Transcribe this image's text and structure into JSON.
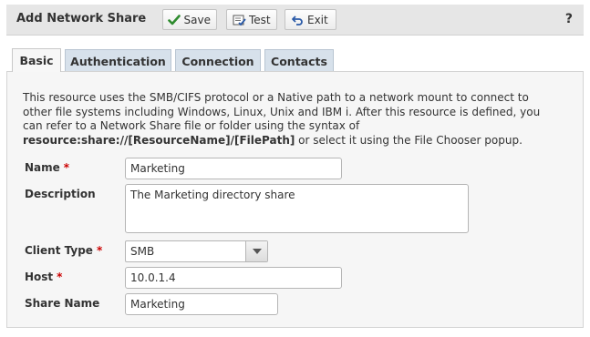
{
  "header": {
    "title": "Add Network Share",
    "save_label": "Save",
    "test_label": "Test",
    "exit_label": "Exit",
    "help_label": "?"
  },
  "tabs": [
    {
      "label": "Basic",
      "active": true
    },
    {
      "label": "Authentication",
      "active": false
    },
    {
      "label": "Connection",
      "active": false
    },
    {
      "label": "Contacts",
      "active": false
    }
  ],
  "description": {
    "line1": "This resource uses the SMB/CIFS protocol or a Native path to a network mount to connect to",
    "line2": "other file systems including Windows, Linux, Unix and IBM i. After this resource is defined, you",
    "line3": "can refer to a Network Share file or folder using the syntax of",
    "syntax": "resource:share://[ResourceName]/[FilePath]",
    "tail": " or select it using the File Chooser popup."
  },
  "form": {
    "name_label": "Name",
    "name_value": "Marketing",
    "description_label": "Description",
    "description_value": "The Marketing directory share",
    "client_type_label": "Client Type",
    "client_type_value": "SMB",
    "host_label": "Host",
    "host_value": "10.0.1.4",
    "share_name_label": "Share Name",
    "share_name_value": "Marketing",
    "required_marker": "*"
  },
  "colors": {
    "header_bg": "#e6e6e6",
    "tab_inactive": "#d7e1eb",
    "panel_bg": "#f6f6f6",
    "required": "#cc0000",
    "save_icon": "#2e8b2e",
    "exit_icon": "#2a5aa8"
  },
  "icons": {
    "save": "checkmark-icon",
    "test": "test-icon",
    "exit": "exit-arrow-icon",
    "dropdown": "chevron-down-icon"
  }
}
